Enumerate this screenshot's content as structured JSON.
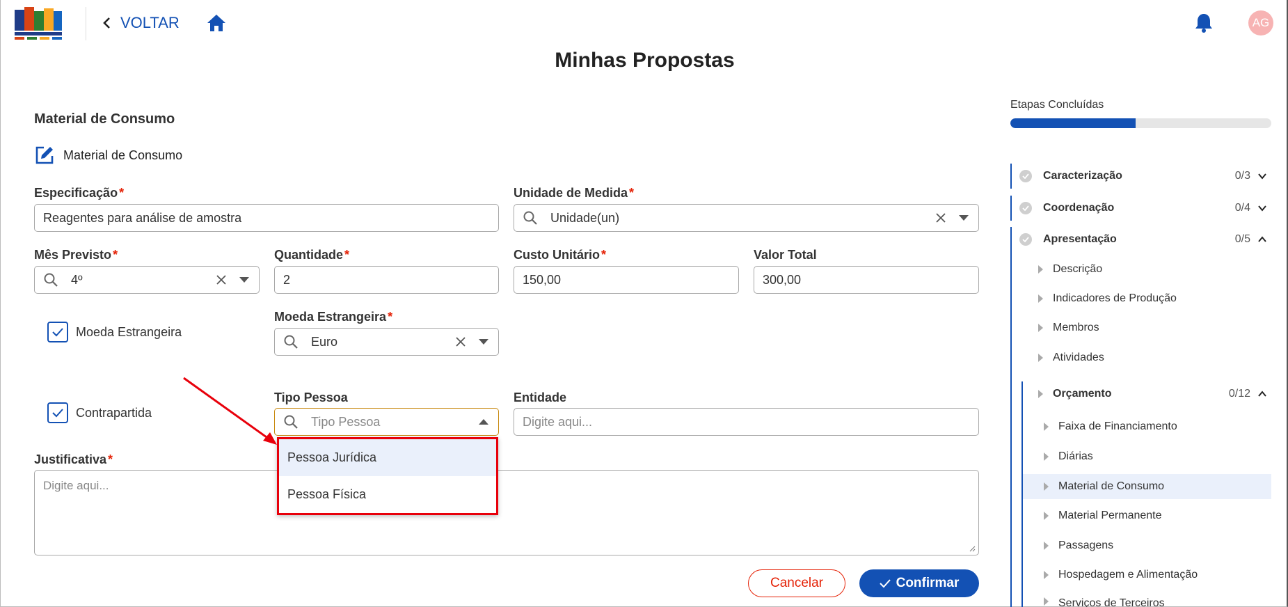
{
  "header": {
    "back_label": "VOLTAR",
    "title": "Minhas Propostas",
    "avatar_initials": "AG",
    "icons": {
      "back": "chevron-left-icon",
      "home": "home-icon",
      "bell": "bell-icon"
    }
  },
  "form": {
    "section_title": "Material de Consumo",
    "subsection_title": "Material de Consumo",
    "especificacao": {
      "label": "Especificação",
      "value": "Reagentes para análise de amostra"
    },
    "unidade": {
      "label": "Unidade de Medida",
      "value": "Unidade(un)"
    },
    "mes": {
      "label": "Mês Previsto",
      "value": "4º"
    },
    "quantidade": {
      "label": "Quantidade",
      "value": "2"
    },
    "custo": {
      "label": "Custo Unitário",
      "value": "150,00"
    },
    "valor_total": {
      "label": "Valor Total",
      "value": "300,00"
    },
    "moeda_checkbox": {
      "label": "Moeda Estrangeira",
      "checked": true
    },
    "moeda": {
      "label": "Moeda Estrangeira",
      "value": "Euro"
    },
    "contrapartida_checkbox": {
      "label": "Contrapartida",
      "checked": true
    },
    "tipo_pessoa": {
      "label": "Tipo Pessoa",
      "placeholder": "Tipo Pessoa",
      "options": [
        "Pessoa Jurídica",
        "Pessoa Física"
      ]
    },
    "entidade": {
      "label": "Entidade",
      "placeholder": "Digite aqui..."
    },
    "justificativa": {
      "label": "Justificativa",
      "placeholder": "Digite aqui..."
    },
    "required_mark": "*",
    "cancel_label": "Cancelar",
    "confirm_label": "Confirmar"
  },
  "sidebar": {
    "title": "Etapas Concluídas",
    "progress_fraction": 0.48,
    "steps": [
      {
        "name": "Caracterização",
        "count": "0/3"
      },
      {
        "name": "Coordenação",
        "count": "0/4"
      },
      {
        "name": "Apresentação",
        "count": "0/5"
      }
    ],
    "apresentacao_items": [
      "Descrição",
      "Indicadores de Produção",
      "Membros",
      "Atividades"
    ],
    "orcamento": {
      "name": "Orçamento",
      "count": "0/12"
    },
    "orcamento_items": [
      "Faixa de Financiamento",
      "Diárias",
      "Material de Consumo",
      "Material Permanente",
      "Passagens",
      "Hospedagem e Alimentação",
      "Serviços de Terceiros"
    ]
  },
  "colors": {
    "primary": "#1351b4",
    "danger": "#e52207",
    "focus": "#c8890f",
    "highlight": "#eaf0fb"
  }
}
